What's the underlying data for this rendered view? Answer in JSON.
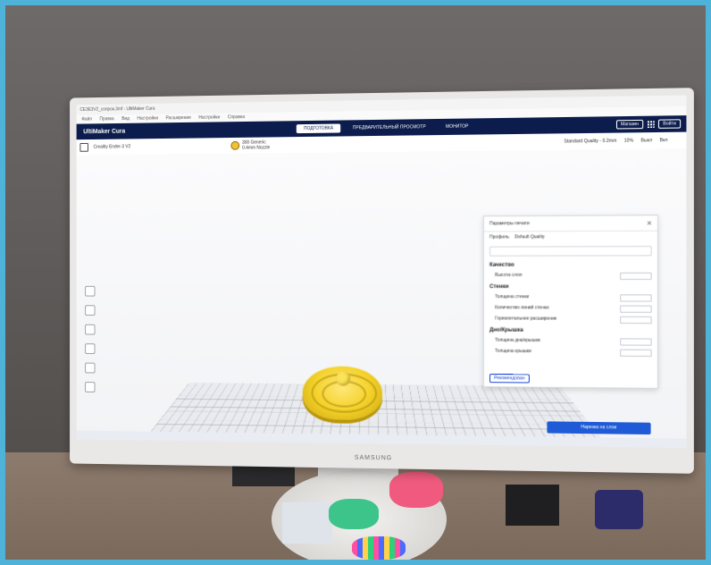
{
  "titlebar": {
    "title": "CE3E3V2_сопрок.3mf - UltiMaker Cura"
  },
  "menu": [
    "Файл",
    "Правка",
    "Вид",
    "Настройки",
    "Расширения",
    "Настройки",
    "Справка"
  ],
  "header": {
    "logo": "UltiMaker Cura",
    "stages": [
      "ПОДГОТОВКА",
      "ПРЕДВАРИТЕЛЬНЫЙ ПРОСМОТР",
      "МОНИТОР"
    ],
    "active_stage": "ПОДГОТОВКА",
    "marketplace": "Магазин",
    "signin": "Войти"
  },
  "toolbar": {
    "printer": "Creality Ender-3 V2",
    "material_line1": "300 Generic",
    "material_line2": "0.4mm Nozzle",
    "profile": "Standard Quality - 0.2mm",
    "infill": "10%",
    "support": "Выкл",
    "adhesion": "Вкл"
  },
  "settings_panel": {
    "title": "Параметры печати",
    "profile_label": "Профиль",
    "profile_value": "Default Quality",
    "categories": [
      {
        "name": "Качество",
        "items": [
          {
            "label": "Высота слоя"
          }
        ]
      },
      {
        "name": "Стенки",
        "items": [
          {
            "label": "Толщина стенки"
          },
          {
            "label": "Количество линий стенки"
          },
          {
            "label": "Горизонтальное расширение"
          }
        ]
      },
      {
        "name": "Дно/Крышка",
        "items": [
          {
            "label": "Толщина дна/крышки"
          },
          {
            "label": "Толщина крышки"
          }
        ]
      }
    ],
    "recommended": "Рекомендован"
  },
  "slice_button": "Нарезка на слои",
  "monitor_brand": "SAMSUNG",
  "colors": {
    "header": "#0c1c4c",
    "accent": "#1f5bd6",
    "model": "#f5d22a",
    "frame": "#4fb3d9"
  }
}
